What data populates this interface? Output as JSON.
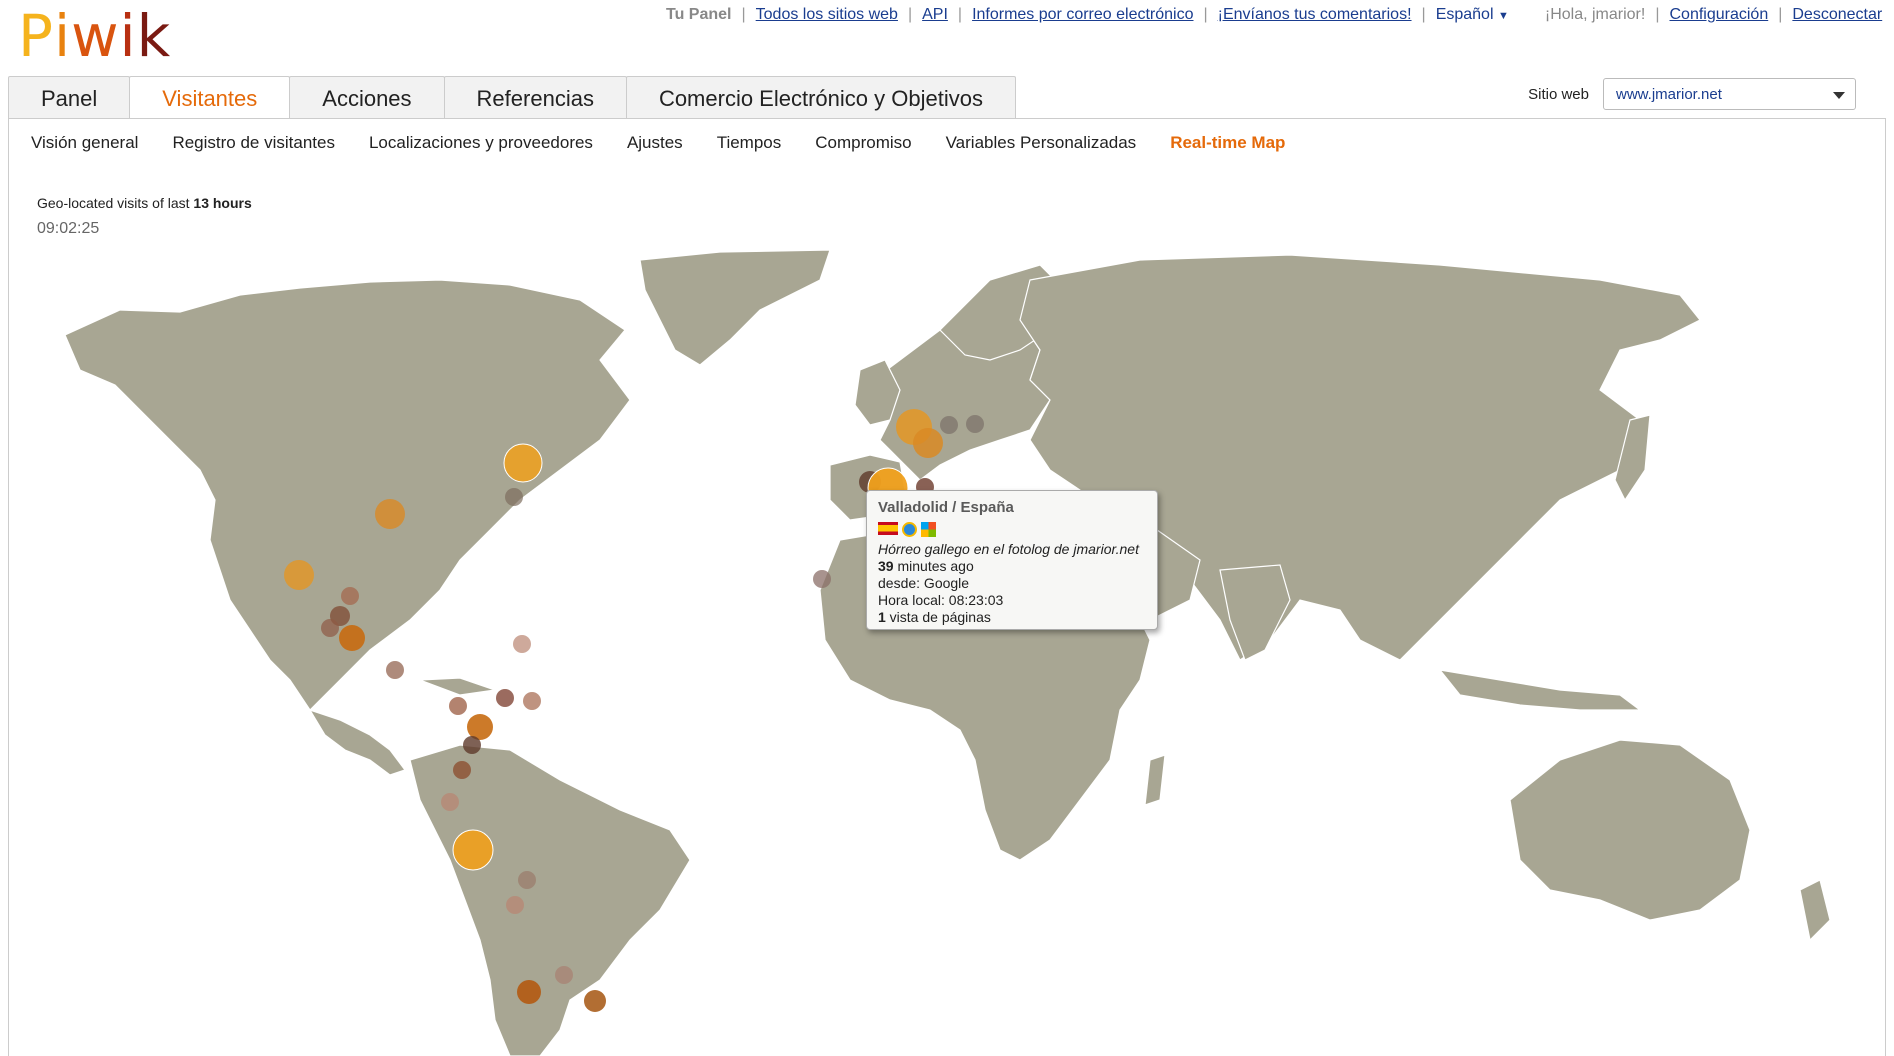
{
  "logo": {
    "text": "Piwik"
  },
  "topnav": {
    "tu_panel": "Tu Panel",
    "todos_sitios": "Todos los sitios web",
    "api": "API",
    "informes": "Informes por correo electrónico",
    "comentarios": "¡Envíanos tus comentarios!",
    "idioma": "Español",
    "saludo": "¡Hola, jmarior!",
    "configuracion": "Configuración",
    "desconectar": "Desconectar"
  },
  "tabs": [
    {
      "label": "Panel"
    },
    {
      "label": "Visitantes"
    },
    {
      "label": "Acciones"
    },
    {
      "label": "Referencias"
    },
    {
      "label": "Comercio Electrónico y Objetivos"
    }
  ],
  "site_selector": {
    "label": "Sitio web",
    "value": "www.jmarior.net"
  },
  "subtabs": [
    {
      "label": "Visión general"
    },
    {
      "label": "Registro de visitantes"
    },
    {
      "label": "Localizaciones y proveedores"
    },
    {
      "label": "Ajustes"
    },
    {
      "label": "Tiempos"
    },
    {
      "label": "Compromiso"
    },
    {
      "label": "Variables Personalizadas"
    },
    {
      "label": "Real-time Map"
    }
  ],
  "geo": {
    "prefix": "Geo-located visits of last",
    "hours": "13 hours",
    "time": "09:02:25"
  },
  "tooltip": {
    "city": "Valladolid / España",
    "page_title": "Hórreo gallego en el fotolog de jmarior.net",
    "minutes_num": "39",
    "minutes_text": " minutes ago",
    "referrer": "desde: Google",
    "local_time": "Hora local: 08:23:03",
    "pageviews_num": "1",
    "pageviews_text": " vista de páginas"
  },
  "colors": {
    "accent": "#e56a0a",
    "land": "#a8a693",
    "visit_new": "#f0a01c",
    "visit_old": "#8b4a2b",
    "link": "#1a3d8f"
  }
}
